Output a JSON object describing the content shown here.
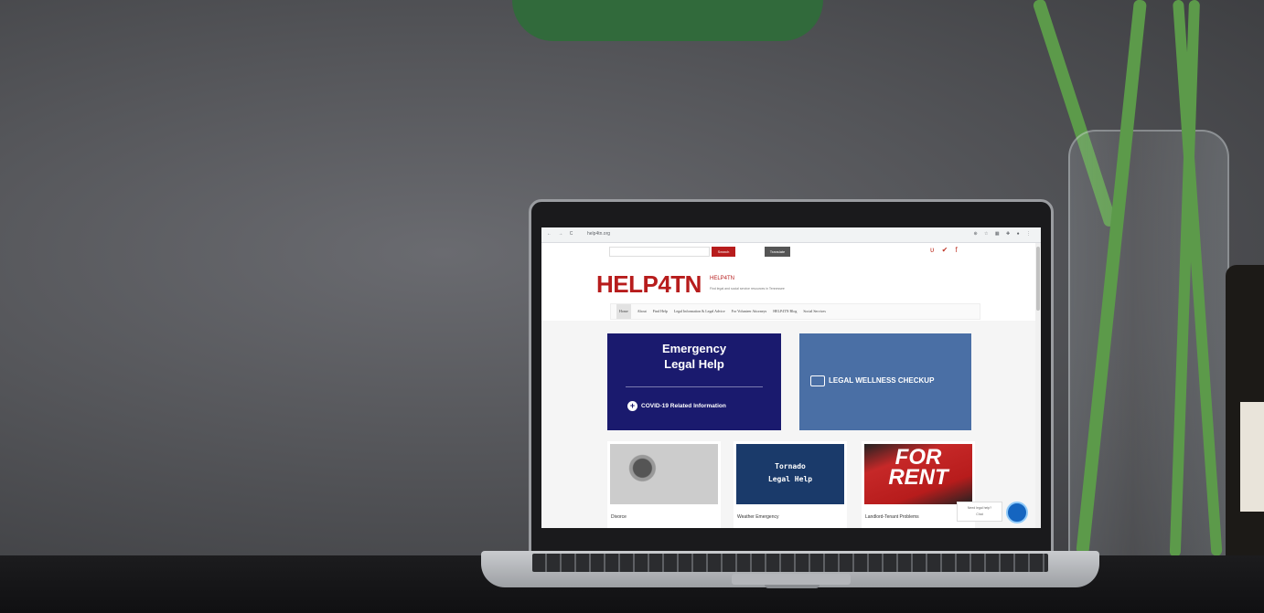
{
  "browser": {
    "url": "help4tn.org",
    "nav_glyphs": "← → C",
    "tools_glyphs": "⊕ ☆ ▦ ✚ ● ⋮"
  },
  "site": {
    "search_label": "Search",
    "translate_label": "Translate",
    "social_icons": [
      "rss-icon",
      "twitter-icon",
      "facebook-icon"
    ],
    "social_glyphs": "ʋ ✔ f",
    "logo": "HELP4TN",
    "logo_small": "HELP4TN",
    "tagline": "Find legal and social service resources in Tennessee",
    "menu": [
      "Home",
      "About",
      "Find Help",
      "Legal Information & Legal Advice",
      "For Volunteer Attorneys",
      "HELP4TN Blog",
      "Social Services"
    ],
    "emergency": {
      "title_line1": "Emergency",
      "title_line2": "Legal Help",
      "covid": "COVID-19 Related Information"
    },
    "wellness": {
      "label": "LEGAL WELLNESS CHECKUP"
    },
    "tiles": [
      {
        "caption": "Divorce"
      },
      {
        "caption": "Weather Emergency",
        "image_line1": "Tornado",
        "image_line2": "Legal Help"
      },
      {
        "caption": "Landlord-Tenant Problems",
        "image_line1": "FOR",
        "image_line2": "RENT"
      }
    ],
    "chat": {
      "line1": "Need legal help?",
      "line2": "Chat"
    }
  },
  "colors": {
    "brand_red": "#b71c1c",
    "navy": "#1a1a6e",
    "wellness_blue": "#4a6fa5",
    "chat_blue": "#1565c0"
  }
}
